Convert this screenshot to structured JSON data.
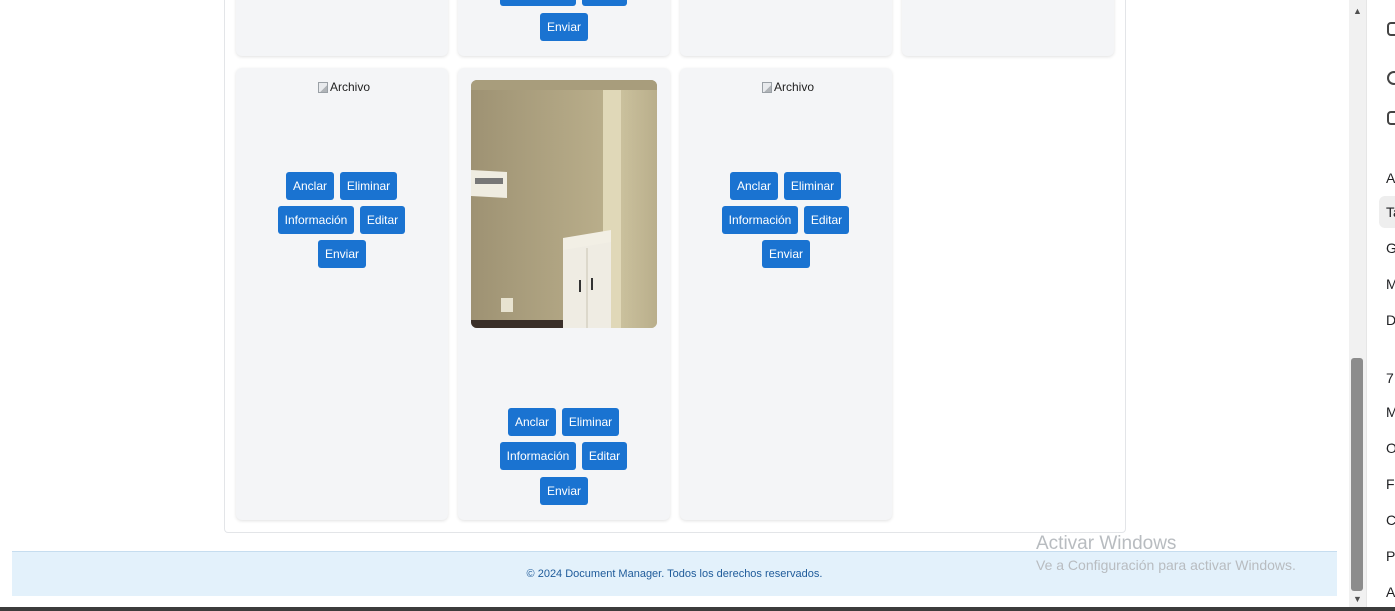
{
  "cards": {
    "top_row": {
      "send_label": "Enviar"
    },
    "card1": {
      "image_alt": "Archivo",
      "pin_label": "Anclar",
      "delete_label": "Eliminar",
      "info_label": "Información",
      "edit_label": "Editar",
      "send_label": "Enviar"
    },
    "card2": {
      "pin_label": "Anclar",
      "delete_label": "Eliminar",
      "info_label": "Información",
      "edit_label": "Editar",
      "send_label": "Enviar"
    },
    "card3": {
      "image_alt": "Archivo",
      "pin_label": "Anclar",
      "delete_label": "Eliminar",
      "info_label": "Información",
      "edit_label": "Editar",
      "send_label": "Enviar"
    }
  },
  "footer": {
    "text": "© 2024 Document Manager. Todos los derechos reservados."
  },
  "windows_watermark": {
    "title": "Activar Windows",
    "subtitle": "Ve a Configuración para activar Windows."
  },
  "side_panel": {
    "items": [
      "Ag",
      "Ta",
      "G",
      "M",
      "D",
      "7",
      "M",
      "O",
      "Fe",
      "C",
      "P",
      "A"
    ]
  },
  "colors": {
    "button": "#1a73d1",
    "card": "#f4f5f7",
    "footer_bg": "#e3f1fb",
    "footer_text": "#1f5b9a"
  }
}
